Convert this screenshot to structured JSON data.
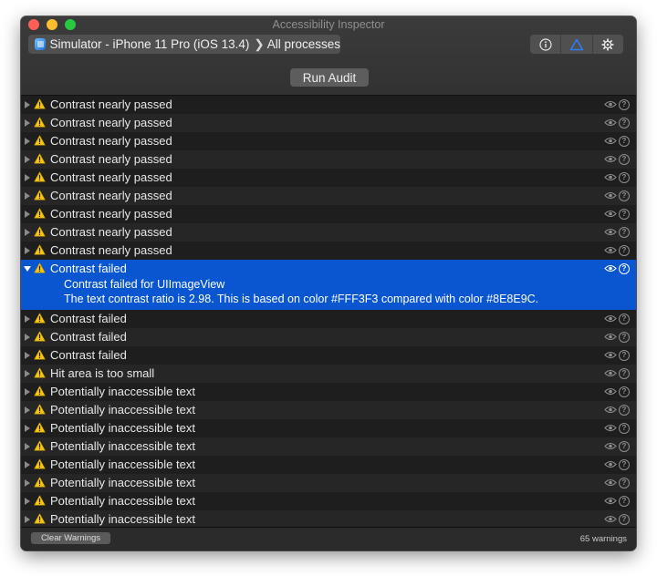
{
  "window": {
    "title": "Accessibility Inspector",
    "target_device": "Simulator - iPhone 11 Pro (iOS 13.4)",
    "target_process": "All processes",
    "toolbar_icons": [
      "info-icon",
      "audit-triangle-icon",
      "gear-icon"
    ],
    "selected_tool": "audit"
  },
  "audit": {
    "run_label": "Run Audit",
    "clear_label": "Clear Warnings",
    "warning_count": "65 warnings"
  },
  "colors": {
    "selection": "#0a56d1",
    "warning": "#f5c518",
    "accent": "#2f7cf6"
  },
  "rows": [
    {
      "label": "Contrast nearly passed"
    },
    {
      "label": "Contrast nearly passed"
    },
    {
      "label": "Contrast nearly passed"
    },
    {
      "label": "Contrast nearly passed"
    },
    {
      "label": "Contrast nearly passed"
    },
    {
      "label": "Contrast nearly passed"
    },
    {
      "label": "Contrast nearly passed"
    },
    {
      "label": "Contrast nearly passed"
    },
    {
      "label": "Contrast nearly passed"
    },
    {
      "label": "Contrast failed",
      "expanded": true,
      "detail_title": "Contrast failed for UIImageView",
      "detail_text": "The text contrast ratio is 2.98. This is based on color #FFF3F3 compared with color #8E8E9C."
    },
    {
      "label": "Contrast failed"
    },
    {
      "label": "Contrast failed"
    },
    {
      "label": "Contrast failed"
    },
    {
      "label": "Hit area is too small"
    },
    {
      "label": "Potentially inaccessible text"
    },
    {
      "label": "Potentially inaccessible text"
    },
    {
      "label": "Potentially inaccessible text"
    },
    {
      "label": "Potentially inaccessible text"
    },
    {
      "label": "Potentially inaccessible text"
    },
    {
      "label": "Potentially inaccessible text"
    },
    {
      "label": "Potentially inaccessible text"
    },
    {
      "label": "Potentially inaccessible text"
    }
  ]
}
